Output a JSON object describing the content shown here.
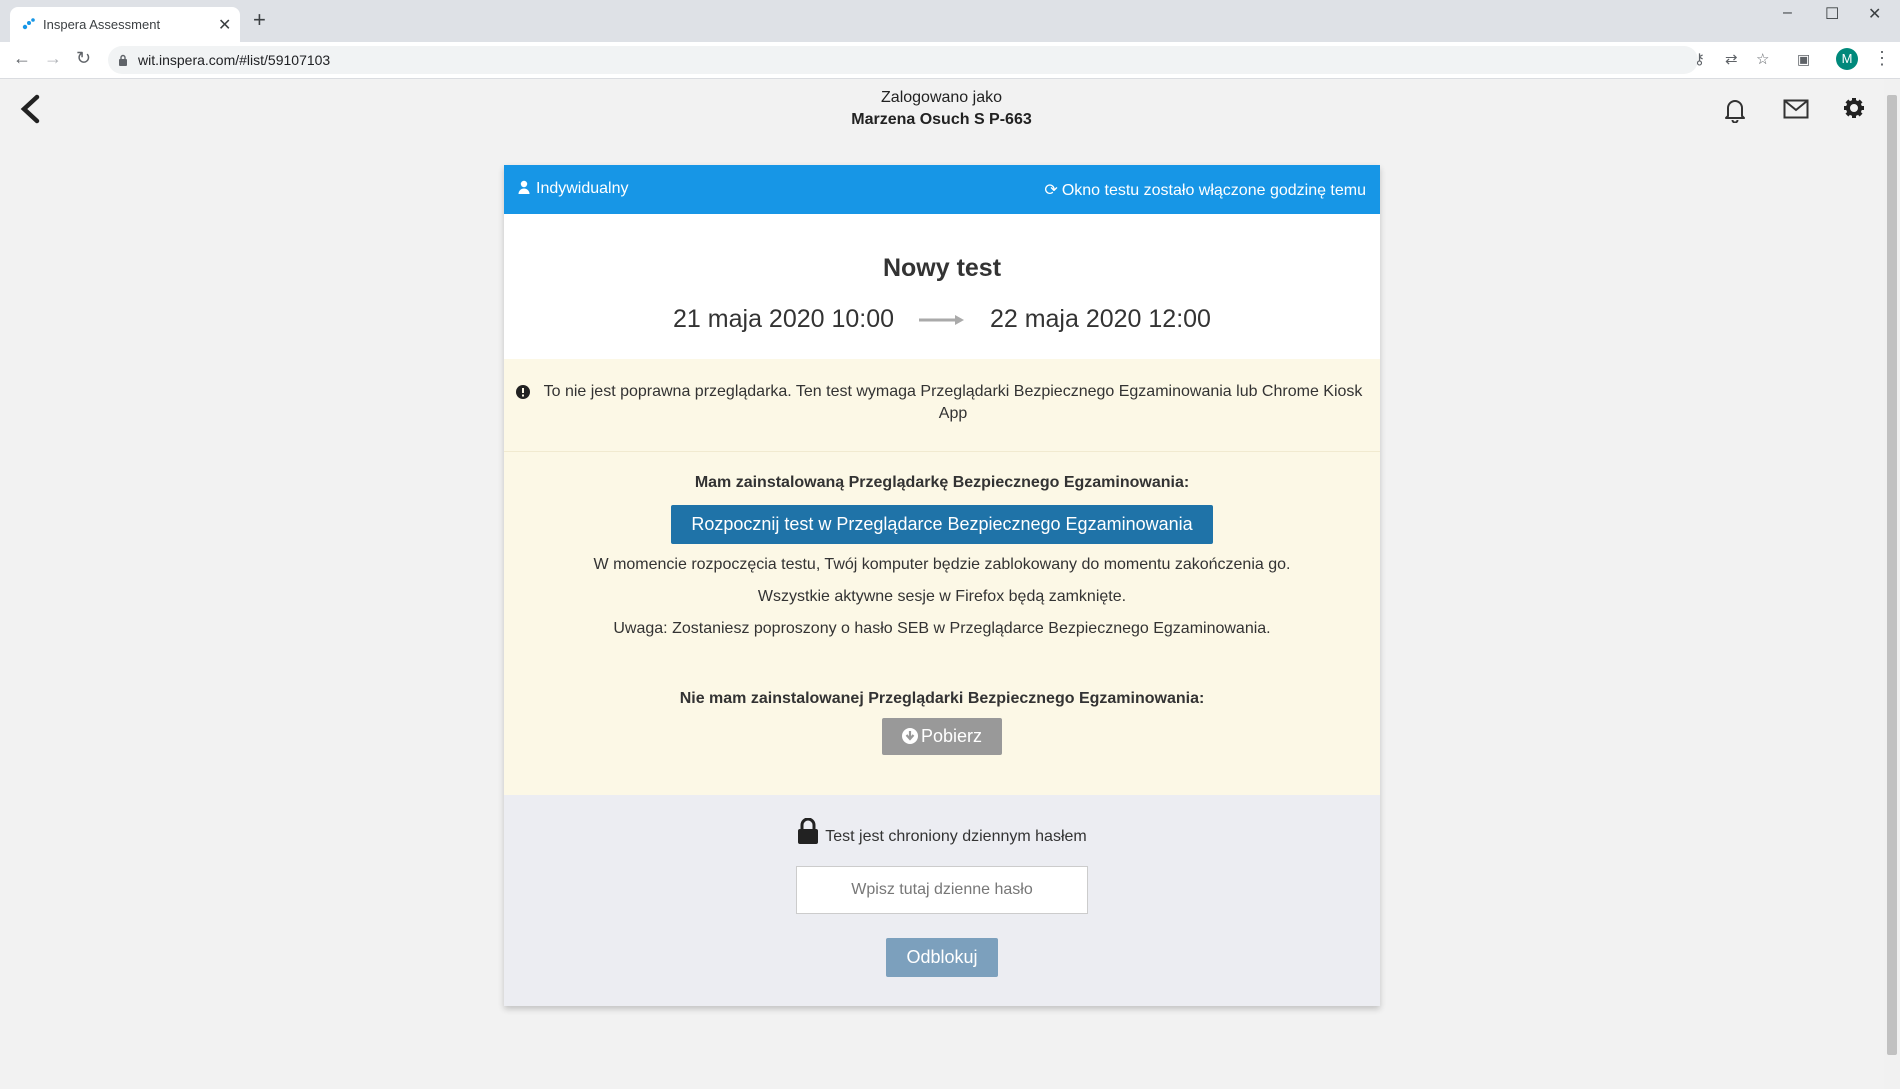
{
  "browser": {
    "tab_title": "Inspera Assessment",
    "url": "wit.inspera.com/#list/59107103",
    "profile_initial": "M"
  },
  "header": {
    "logged_as_label": "Zalogowano jako",
    "user_name": "Marzena Osuch S P-663"
  },
  "card": {
    "type_label": "Indywidualny",
    "window_status": "Okno testu zostało włączone godzinę temu",
    "test_name": "Nowy test",
    "start_date": "21 maja 2020 10:00",
    "end_date": "22 maja 2020 12:00",
    "warning": "To nie jest poprawna przeglądarka. Ten test wymaga Przeglądarki Bezpiecznego Egzaminowania lub Chrome Kiosk App",
    "seb_installed_label": "Mam zainstalowaną Przeglądarkę Bezpiecznego Egzaminowania:",
    "start_button": "Rozpocznij test w Przeglądarce Bezpiecznego Egzaminowania",
    "info_lines": [
      "W momencie rozpoczęcia testu, Twój komputer będzie zablokowany do momentu zakończenia go.",
      "Wszystkie aktywne sesje w Firefox będą zamknięte.",
      "Uwaga: Zostaniesz poproszony o hasło SEB w Przeglądarce Bezpiecznego Egzaminowania."
    ],
    "seb_not_installed_label": "Nie mam zainstalowanej Przeglądarki Bezpiecznego Egzaminowania:",
    "download_button": "Pobierz",
    "password_notice": "Test jest chroniony dziennym hasłem",
    "password_placeholder": "Wpisz tutaj dzienne hasło",
    "unlock_button": "Odblokuj"
  },
  "colors": {
    "header_blue": "#1796e6",
    "start_button": "#1f73a8",
    "warning_bg": "#fcf8e6",
    "password_bg": "#ecedf2"
  }
}
